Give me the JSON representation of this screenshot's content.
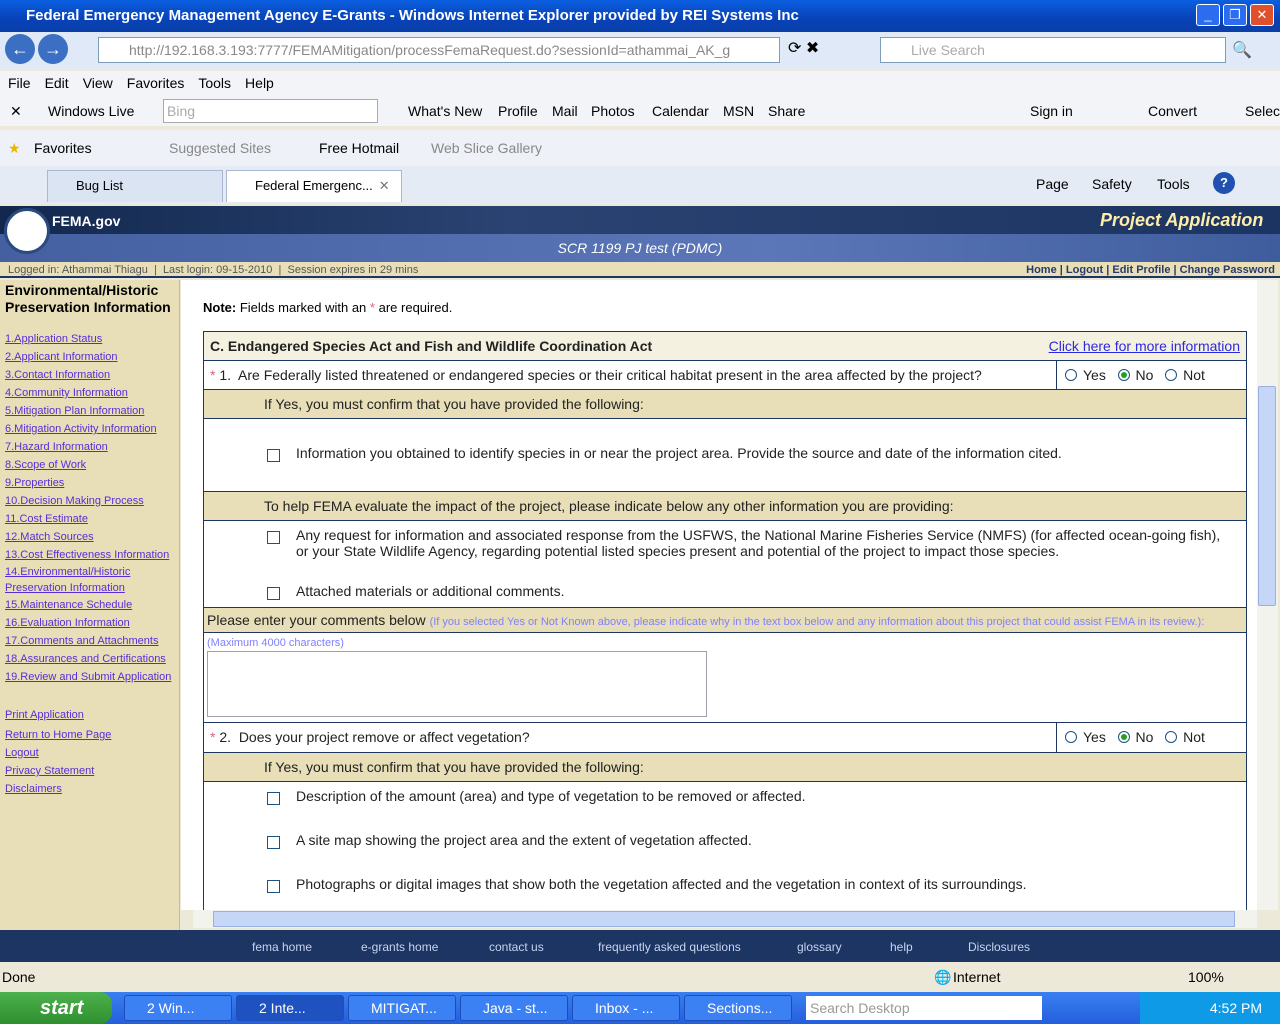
{
  "window": {
    "title": "Federal Emergency Management Agency E-Grants - Windows Internet Explorer provided by REI Systems Inc"
  },
  "address": {
    "url": "http://192.168.3.193:7777/FEMAMitigation/processFemaRequest.do?sessionId=athammai_AK_g",
    "search_placeholder": "Live Search"
  },
  "menu": [
    "File",
    "Edit",
    "View",
    "Favorites",
    "Tools",
    "Help"
  ],
  "wl_toolbar": {
    "brand": "Windows Live",
    "search_placeholder": "Bing",
    "items": [
      "What's New",
      "Profile",
      "Mail",
      "Photos",
      "Calendar",
      "MSN",
      "Share"
    ],
    "sign_in": "Sign in",
    "convert": "Convert",
    "select": "Select"
  },
  "favorites_bar": {
    "favorites": "Favorites",
    "items": [
      "Suggested Sites",
      "Free Hotmail",
      "Web Slice Gallery"
    ]
  },
  "tabs": [
    {
      "label": "Bug List"
    },
    {
      "label": "Federal Emergenc..."
    }
  ],
  "command_bar": [
    "Page",
    "Safety",
    "Tools"
  ],
  "fema": {
    "logo": "FEMA.gov",
    "app_title": "Project Application",
    "project": "SCR 1199 PJ test (PDMC)",
    "logged_in": "Logged in: Athammai Thiagu",
    "last_login": "Last login: 09-15-2010",
    "session": "Session expires in 29 mins",
    "links": [
      "Home",
      "Logout",
      "Edit Profile",
      "Change Password"
    ]
  },
  "sidebar": {
    "title": "Environmental/Historic Preservation Information",
    "items": [
      "1.Application Status",
      "2.Applicant Information",
      "3.Contact Information",
      "4.Community Information",
      "5.Mitigation Plan Information",
      "6.Mitigation Activity Information",
      "7.Hazard Information",
      "8.Scope of Work",
      "9.Properties",
      "10.Decision Making Process",
      "11.Cost Estimate",
      "12.Match Sources",
      "13.Cost Effectiveness Information",
      "14.Environmental/Historic Preservation Information",
      "15.Maintenance Schedule",
      "16.Evaluation Information",
      "17.Comments and Attachments",
      "18.Assurances and Certifications",
      "19.Review and Submit Application"
    ],
    "extra": [
      "Print Application",
      "Return to Home Page",
      "Logout",
      "Privacy Statement",
      "Disclaimers"
    ]
  },
  "form": {
    "note_label": "Note:",
    "note_text": "Fields marked with an",
    "note_star": "*",
    "note_end": "are required.",
    "section_title": "C. Endangered Species Act and Fish and Wildlife Coordination Act",
    "more_info": "Click here for more information",
    "radio_labels": [
      "Yes",
      "No",
      "Not Known"
    ],
    "q1": {
      "num": "1.",
      "text": "Are Federally listed threatened or endangered species or their critical habitat present in the area affected by the project?",
      "selected": "No"
    },
    "q1_confirm": "If Yes, you must confirm that you have provided the following:",
    "q1_items": [
      "Information you obtained to identify species in or near the project area. Provide the source and date of the information cited."
    ],
    "other_info": "To help FEMA evaluate the impact of the project, please indicate below any other information you are providing:",
    "other_items": [
      "Any request for information and associated response from the USFWS, the National Marine Fisheries Service (NMFS) (for affected ocean-going fish), or your State Wildlife Agency, regarding potential listed species present and potential of the project to impact those species.",
      "Attached materials or additional comments."
    ],
    "comments_label": "Please enter your comments below",
    "comments_hint": "(If you selected Yes or Not Known above, please indicate why in the text box below and any information about this project that could assist FEMA in its review.):",
    "max_chars": "(Maximum 4000 characters)",
    "comments_value": "",
    "q2": {
      "num": "2.",
      "text": "Does your project remove or affect vegetation?",
      "selected": "No"
    },
    "q2_confirm": "If Yes, you must confirm that you have provided the following:",
    "q2_items": [
      "Description of the amount (area) and type of vegetation to be removed or affected.",
      "A site map showing the project area and the extent of vegetation affected.",
      "Photographs or digital images that show both the vegetation affected and the vegetation in context of its surroundings."
    ]
  },
  "footer": [
    "fema home",
    "e-grants home",
    "contact us",
    "frequently asked questions",
    "glossary",
    "help",
    "Disclosures"
  ],
  "status": {
    "text": "Done",
    "zone": "Internet",
    "zoom": "100%"
  },
  "taskbar": {
    "start": "start",
    "items": [
      "2 Win...",
      "2 Inte...",
      "MITIGAT...",
      "Java - st...",
      "Inbox - ...",
      "Sections..."
    ],
    "search_placeholder": "Search Desktop",
    "time": "4:52 PM"
  }
}
